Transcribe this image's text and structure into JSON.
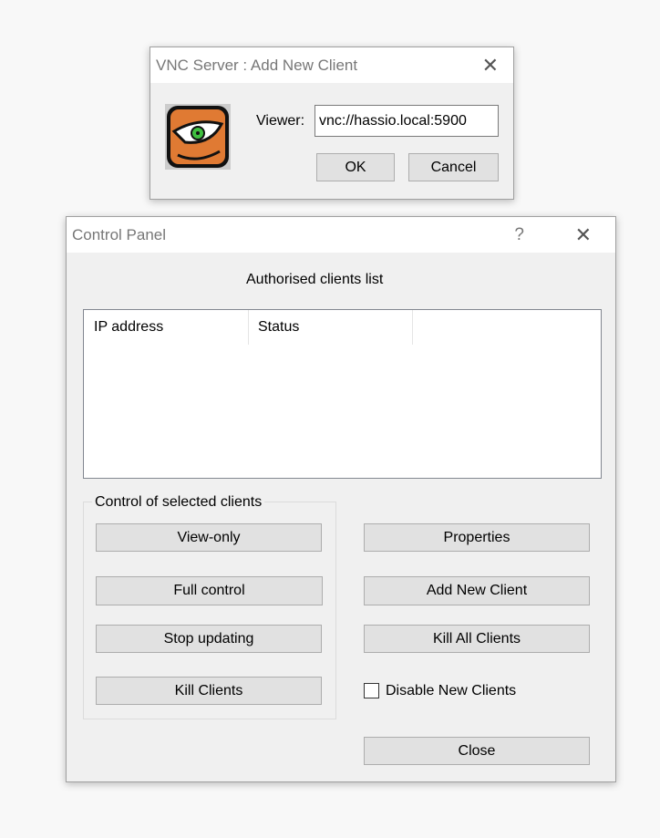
{
  "add_dialog": {
    "title": "VNC Server : Add New Client",
    "viewer_label": "Viewer:",
    "viewer_value": "vnc://hassio.local:5900",
    "ok": "OK",
    "cancel": "Cancel"
  },
  "control_panel": {
    "title": "Control Panel",
    "help": "?",
    "list_title": "Authorised clients list",
    "columns": [
      "IP address",
      "Status",
      ""
    ],
    "group_label": "Control of selected clients",
    "view_only": "View-only",
    "full_control": "Full control",
    "stop_updating": "Stop updating",
    "kill_clients": "Kill Clients",
    "properties": "Properties",
    "add_new_client": "Add New Client",
    "kill_all_clients": "Kill All Clients",
    "disable_new_clients": "Disable New Clients",
    "disable_new_clients_checked": false,
    "close": "Close"
  }
}
